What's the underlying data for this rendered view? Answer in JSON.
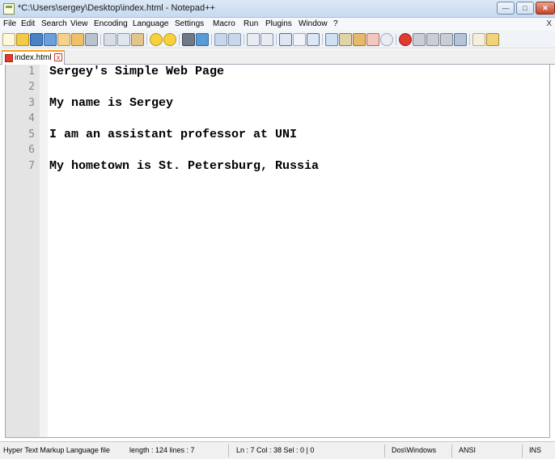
{
  "window": {
    "title": "*C:\\Users\\sergey\\Desktop\\index.html - Notepad++",
    "minimize_glyph": "—",
    "maximize_glyph": "□",
    "close_glyph": "✕"
  },
  "menu": {
    "items": [
      "File",
      "Edit",
      "Search",
      "View",
      "Encoding",
      "Language",
      "Settings",
      "Macro",
      "Run",
      "Plugins",
      "Window",
      "?"
    ],
    "close_label": "X"
  },
  "toolbar": {
    "icons": [
      "new-file-icon",
      "open-file-icon",
      "save-icon",
      "save-all-icon",
      "close-icon",
      "close-all-icon",
      "print-icon",
      "cut-icon",
      "copy-icon",
      "paste-icon",
      "undo-icon",
      "redo-icon",
      "find-icon",
      "replace-icon",
      "zoom-in-icon",
      "zoom-out-icon",
      "sync-vertical-icon",
      "sync-horizontal-icon",
      "word-wrap-icon",
      "show-all-chars-icon",
      "indent-guide-icon",
      "doc-map-icon",
      "function-list-icon",
      "folder-workspace-icon",
      "monitoring-icon",
      "record-macro-icon",
      "stop-macro-icon",
      "play-macro-icon",
      "run-macro-multiple-icon",
      "save-macro-icon",
      "spell-check-icon",
      "spell-options-icon"
    ]
  },
  "tab": {
    "label": "index.html",
    "close_glyph": "x"
  },
  "editor": {
    "lines": [
      {
        "no": "1",
        "text": "Sergey's Simple Web Page"
      },
      {
        "no": "2",
        "text": ""
      },
      {
        "no": "3",
        "text": "My name is Sergey"
      },
      {
        "no": "4",
        "text": ""
      },
      {
        "no": "5",
        "text": "I am an assistant professor at UNI"
      },
      {
        "no": "6",
        "text": ""
      },
      {
        "no": "7",
        "text": "My hometown is St. Petersburg, Russia"
      }
    ]
  },
  "status": {
    "file_type": "Hyper Text Markup Language file",
    "length": "length : 124   lines : 7",
    "position": "Ln : 7   Col : 38   Sel : 0 | 0",
    "eol": "Dos\\Windows",
    "encoding": "ANSI",
    "mode": "INS"
  },
  "colors": {
    "tab_accent": "#f7a01e",
    "gutter": "#e4e4e4"
  }
}
